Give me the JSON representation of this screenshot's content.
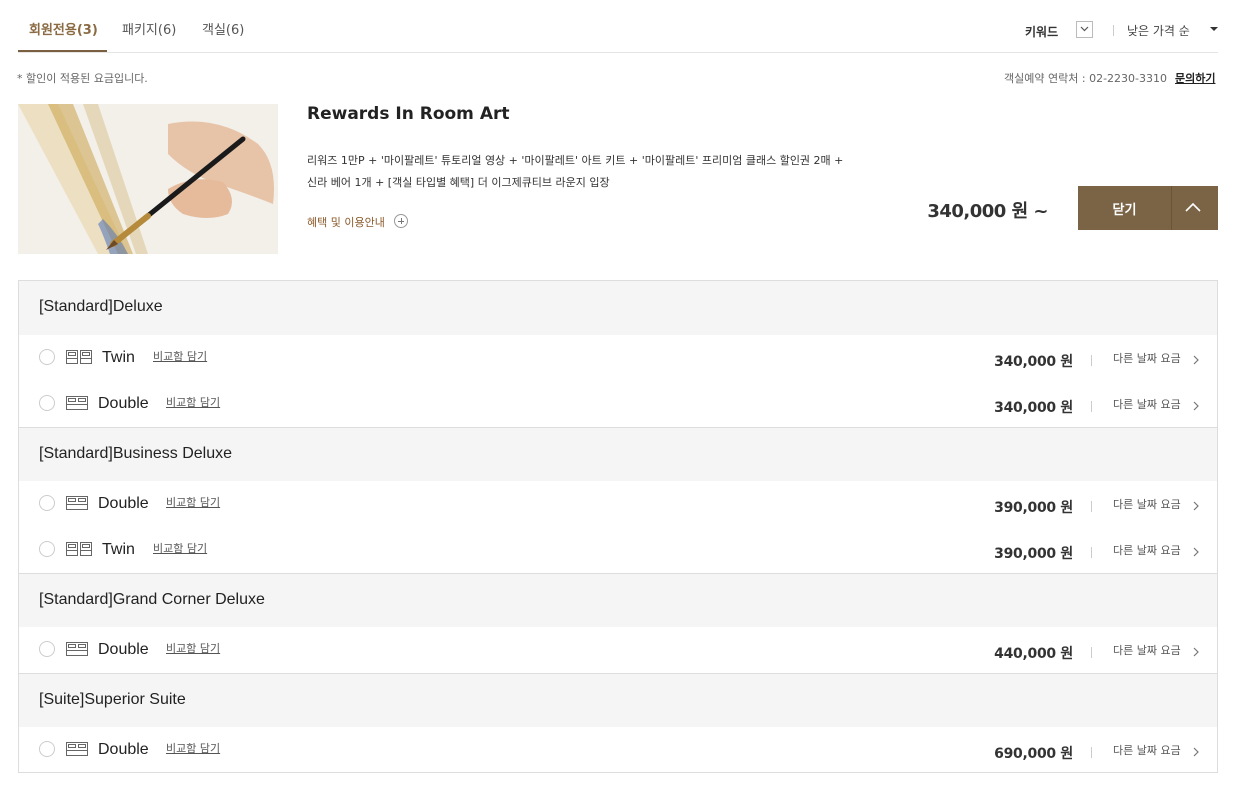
{
  "tabs": [
    {
      "label": "회원전용(3)",
      "active": true
    },
    {
      "label": "패키지(6)",
      "active": false
    },
    {
      "label": "객실(6)",
      "active": false
    }
  ],
  "filter": {
    "keyword_label": "키워드",
    "sort_label": "낮은 가격 순"
  },
  "notice": "* 할인이 적용된 요금입니다.",
  "contact": {
    "text": "객실예약 연락처 : 02-2230-3310",
    "inquiry_label": "문의하기"
  },
  "package": {
    "title": "Rewards In Room Art",
    "description": "리워즈 1만P + '마이팔레트' 튜토리얼 영상 + '마이팔레트' 아트 키트 + '마이팔레트' 프리미엄 클래스 할인권 2매 + 신라 베어 1개 + [객실 타입별 혜택] 더 이그제큐티브 라운지 입장",
    "benefit_label": "혜택 및 이용안내",
    "price": "340,000 원 ~",
    "close_label": "닫기"
  },
  "room_groups": [
    {
      "name": "[Standard]Deluxe",
      "rooms": [
        {
          "bed": "Twin",
          "icon": "twin-bed-icon",
          "compare": "비교함 담기",
          "price": "340,000 원",
          "other": "다른 날짜 요금"
        },
        {
          "bed": "Double",
          "icon": "double-bed-icon",
          "compare": "비교함 담기",
          "price": "340,000 원",
          "other": "다른 날짜 요금"
        }
      ]
    },
    {
      "name": "[Standard]Business Deluxe",
      "rooms": [
        {
          "bed": "Double",
          "icon": "double-bed-icon",
          "compare": "비교함 담기",
          "price": "390,000 원",
          "other": "다른 날짜 요금"
        },
        {
          "bed": "Twin",
          "icon": "twin-bed-icon",
          "compare": "비교함 담기",
          "price": "390,000 원",
          "other": "다른 날짜 요금"
        }
      ]
    },
    {
      "name": "[Standard]Grand Corner Deluxe",
      "rooms": [
        {
          "bed": "Double",
          "icon": "double-bed-icon",
          "compare": "비교함 담기",
          "price": "440,000 원",
          "other": "다른 날짜 요금"
        }
      ]
    },
    {
      "name": "[Suite]Superior Suite",
      "rooms": [
        {
          "bed": "Double",
          "icon": "double-bed-icon",
          "compare": "비교함 담기",
          "price": "690,000 원",
          "other": "다른 날짜 요금"
        }
      ]
    }
  ],
  "colors": {
    "accent": "#7b6446",
    "tab_active": "#8a6b43",
    "benefit": "#8a5a2b"
  }
}
